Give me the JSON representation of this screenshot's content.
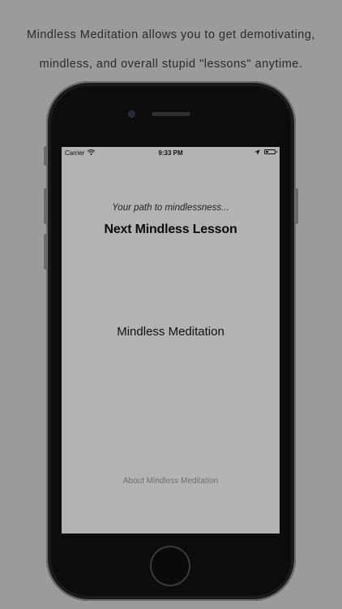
{
  "caption": {
    "line1": "Mindless Meditation allows you to get demotivating,",
    "line2": "mindless, and overall stupid \"lessons\" anytime."
  },
  "status_bar": {
    "carrier": "Carrier",
    "time": "9:33 PM",
    "icons": [
      "wifi-icon",
      "location-icon",
      "battery-icon"
    ]
  },
  "app": {
    "tagline": "Your path to mindlessness...",
    "next_lesson_label": "Next Mindless Lesson",
    "lesson_text": "Mindless Meditation",
    "about_label": "About Mindless Meditation"
  },
  "colors": {
    "background": "#9b9b9b",
    "screen": "#b3b3b3",
    "phone_body": "#2c2c2e"
  }
}
